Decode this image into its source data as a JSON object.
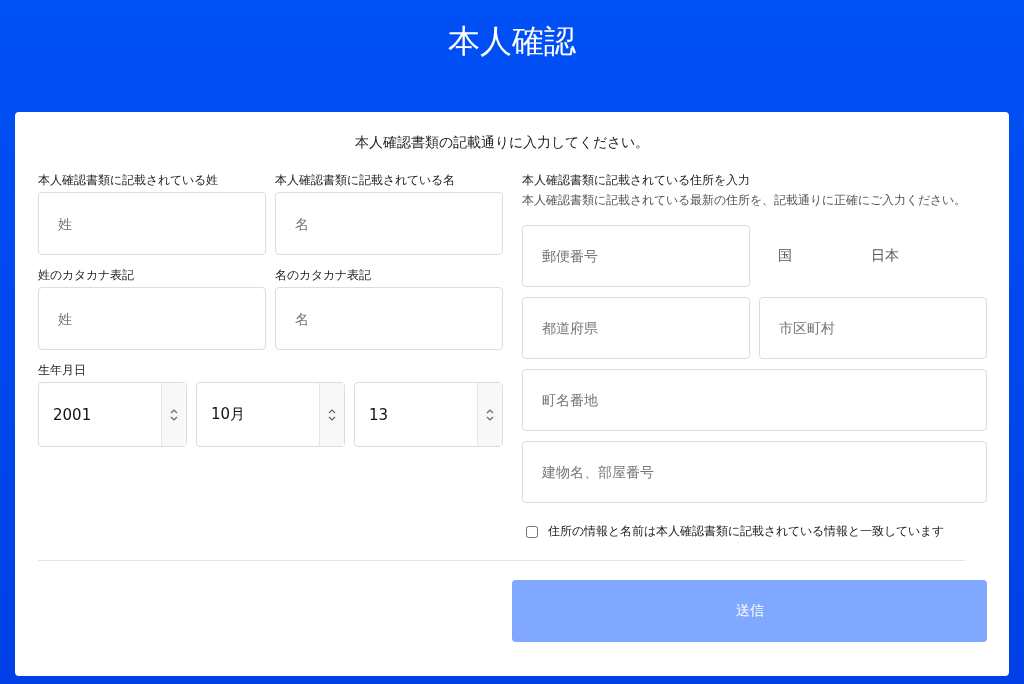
{
  "title": "本人確認",
  "intro": "本人確認書類の記載通りに入力してください。",
  "name_fields": [
    {
      "label": "本人確認書類に記載されている姓",
      "placeholder": "姓"
    },
    {
      "label": "本人確認書類に記載されている名",
      "placeholder": "名"
    },
    {
      "label": "姓のカタカナ表記",
      "placeholder": "姓"
    },
    {
      "label": "名のカタカナ表記",
      "placeholder": "名"
    }
  ],
  "birthdate": {
    "label": "生年月日",
    "selects": [
      {
        "value": "2001"
      },
      {
        "value": "10月"
      },
      {
        "value": "13"
      }
    ]
  },
  "address": {
    "label": "本人確認書類に記載されている住所を入力",
    "hint": "本人確認書類に記載されている最新の住所を、記載通りに正確にご入力ください。",
    "fields": [
      {
        "kind": "input",
        "placeholder": "郵便番号",
        "wide": false
      },
      {
        "kind": "static",
        "label": "国",
        "value": "日本"
      },
      {
        "kind": "input",
        "placeholder": "都道府県",
        "wide": false
      },
      {
        "kind": "input",
        "placeholder": "市区町村",
        "wide": false
      },
      {
        "kind": "input",
        "placeholder": "町名番地",
        "wide": true
      },
      {
        "kind": "input",
        "placeholder": "建物名、部屋番号",
        "wide": true
      }
    ]
  },
  "confirm": {
    "label": "住所の情報と名前は本人確認書類に記載されている情報と一致しています",
    "checked": false
  },
  "submit": {
    "label": "送信",
    "disabled": true
  }
}
